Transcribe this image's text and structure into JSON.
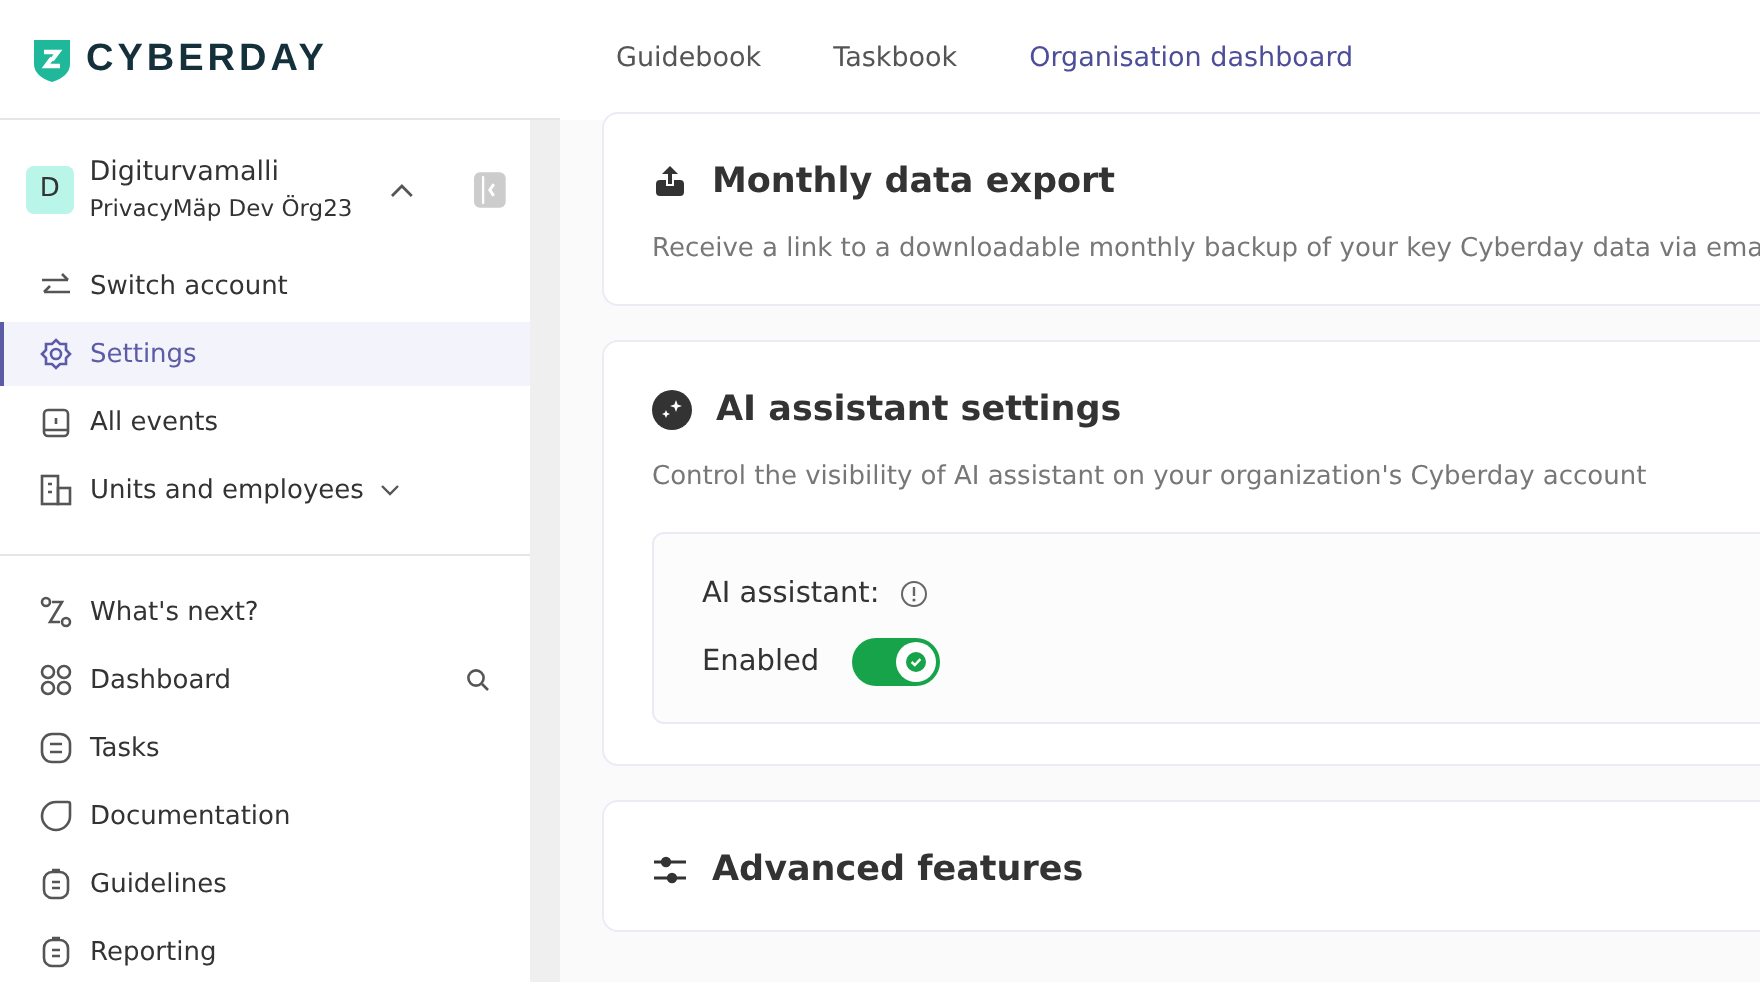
{
  "logo": {
    "text": "CYBERDAY"
  },
  "tabs": [
    {
      "label": "Guidebook",
      "selected": false
    },
    {
      "label": "Taskbook",
      "selected": false
    },
    {
      "label": "Organisation dashboard",
      "selected": true
    }
  ],
  "account": {
    "initial": "D",
    "name": "Digiturvamalli",
    "org": "PrivacyMäp Dev Örg23",
    "expanded": true
  },
  "sidebar": {
    "groups": [
      {
        "items": [
          {
            "label": "Switch account",
            "selected": false
          },
          {
            "label": "Settings",
            "selected": true
          },
          {
            "label": "All events",
            "selected": false
          },
          {
            "label": "Units and employees",
            "selected": false,
            "expanded": false
          }
        ]
      },
      {
        "items": [
          {
            "label": "What's next?",
            "selected": false
          },
          {
            "label": "Dashboard",
            "selected": false,
            "search": true
          },
          {
            "label": "Tasks",
            "selected": false
          },
          {
            "label": "Documentation",
            "selected": false
          },
          {
            "label": "Guidelines",
            "selected": false
          },
          {
            "label": "Reporting",
            "selected": false
          }
        ]
      }
    ]
  },
  "cards": [
    {
      "kind": "export",
      "title": "Monthly data export",
      "description": "Receive a link to a downloadable monthly backup of your key Cyberday data via ema"
    },
    {
      "kind": "ai",
      "title": "AI assistant settings",
      "description": "Control the visibility of AI assistant on your organization's Cyberday account",
      "setting": {
        "label": "AI assistant:",
        "toggle_label": "Enabled",
        "on": true
      }
    },
    {
      "kind": "advanced",
      "title": "Advanced features"
    }
  ]
}
